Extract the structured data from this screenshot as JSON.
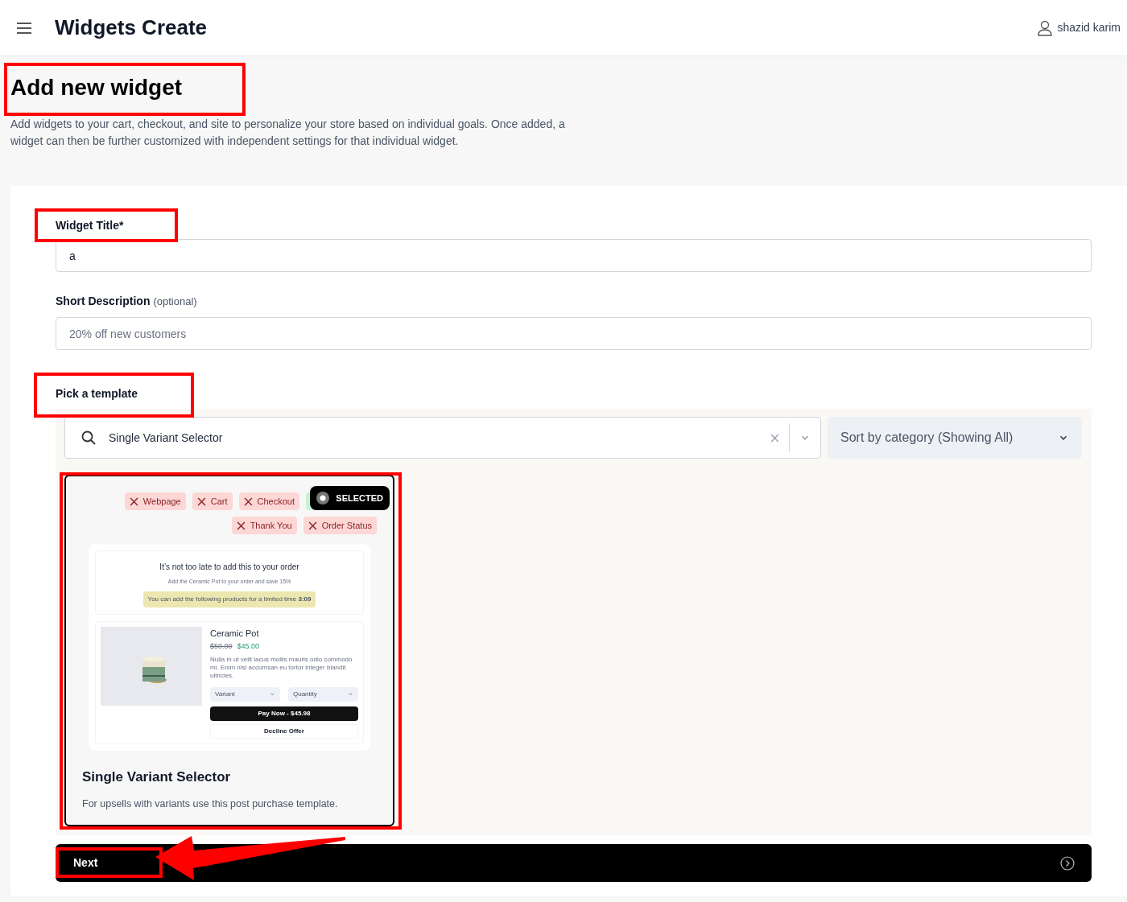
{
  "header": {
    "title": "Widgets Create",
    "user": "shazid karim"
  },
  "intro": {
    "heading": "Add new widget",
    "description": "Add widgets to your cart, checkout, and site to personalize your store based on individual goals. Once added, a widget can then be further customized with independent settings for that individual widget."
  },
  "form": {
    "widget_title": {
      "label": "Widget Title*",
      "value": "a"
    },
    "short_description": {
      "label": "Short Description",
      "hint": "(optional)",
      "placeholder": "20% off new customers"
    },
    "template_label": "Pick a template",
    "search": {
      "value": "Single Variant Selector"
    },
    "sort": {
      "value": "Sort by category (Showing All)"
    },
    "templates": [
      {
        "selected": true,
        "badge": "SELECTED",
        "name": "Single Variant Selector",
        "description": "For upsells with variants use this post purchase template.",
        "tags": [
          {
            "label": "Webpage",
            "included": false
          },
          {
            "label": "Cart",
            "included": false
          },
          {
            "label": "Checkout",
            "included": false
          },
          {
            "included": true
          },
          {
            "label": "Thank You",
            "included": false
          },
          {
            "label": "Order Status",
            "included": false
          }
        ],
        "preview": {
          "headline": "It’s not too late to add this to your order",
          "subline": "Add the Ceramic Pot to your order and save 15%",
          "timer_text": "You can add the following products for a limited time **3:09**",
          "product": "Ceramic Pot",
          "old_price": "$50.00",
          "price": "$45.00",
          "blurb": "Nulla in ut velit lacus mollis mauris odio commodo mi. Enim nisl accumsan eu tortor integer blandit ultricies.",
          "variant": "Variant",
          "quantity": "Quantity",
          "pay": "Pay Now - $45.98",
          "decline": "Decline Offer"
        }
      }
    ],
    "next": "Next"
  }
}
